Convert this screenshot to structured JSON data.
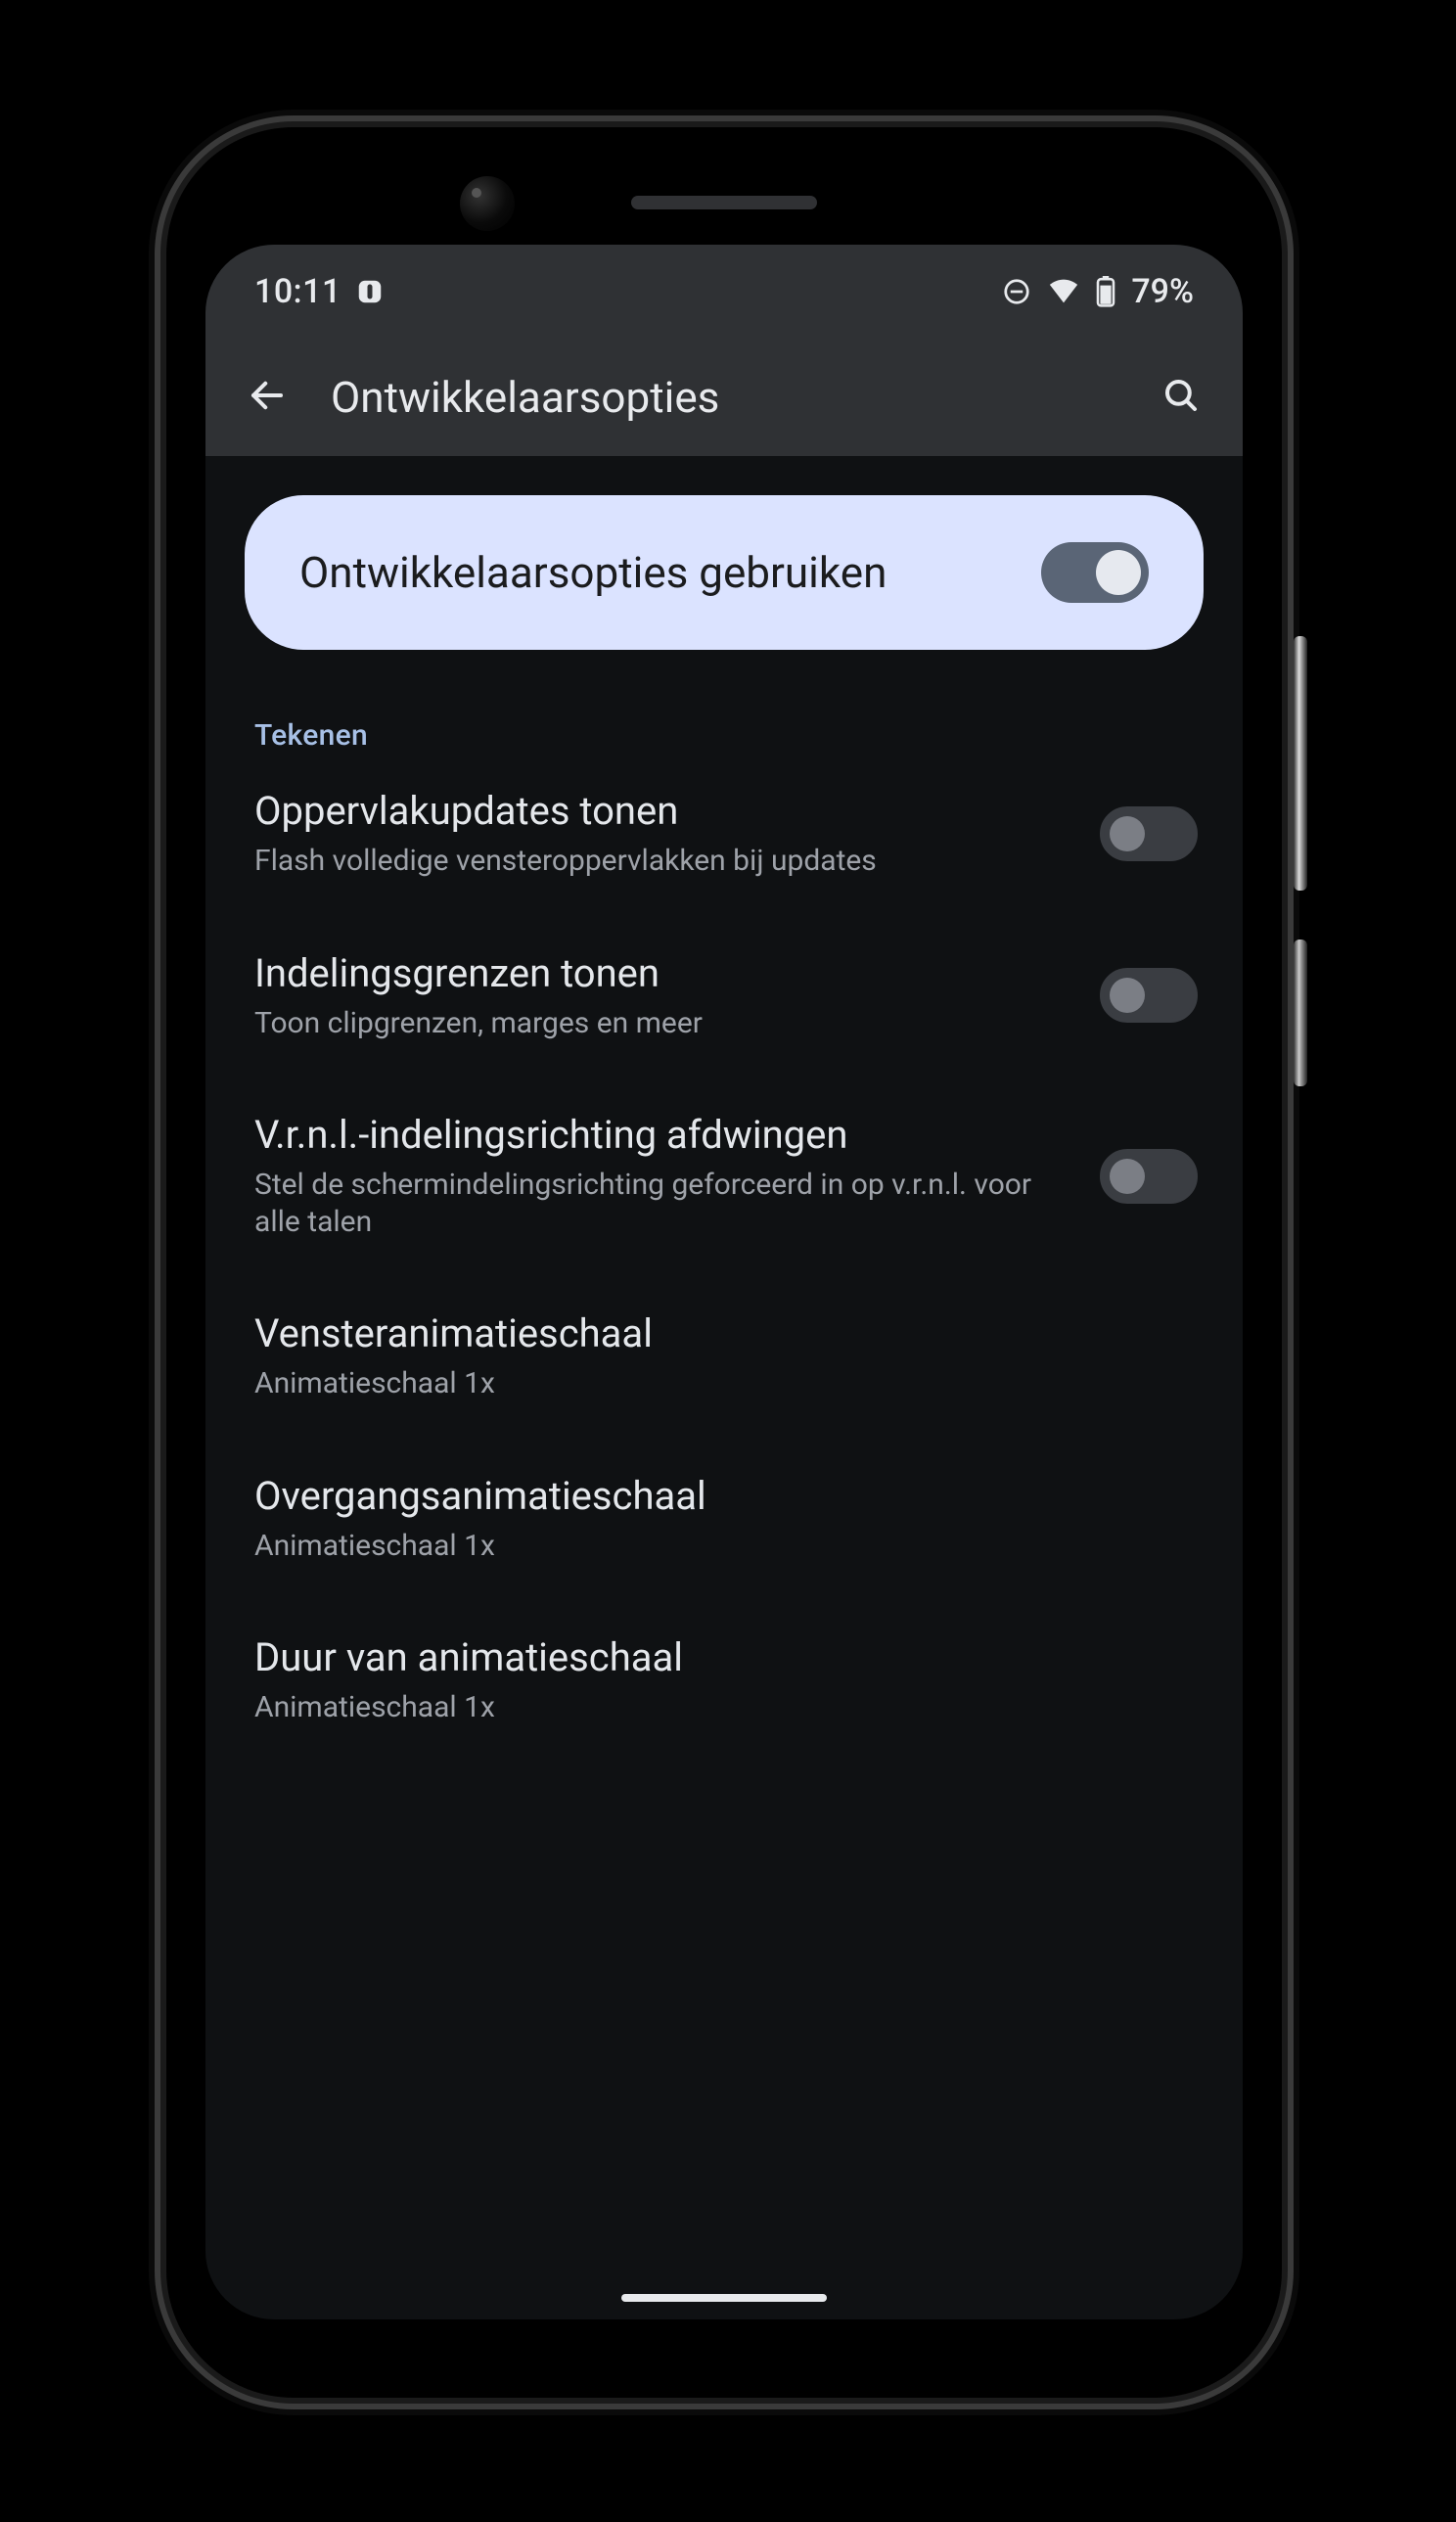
{
  "statusbar": {
    "time": "10:11",
    "battery_text": "79%"
  },
  "appbar": {
    "title": "Ontwikkelaarsopties"
  },
  "master": {
    "label": "Ontwikkelaarsopties gebruiken"
  },
  "section": {
    "header": "Tekenen"
  },
  "rows": [
    {
      "title": "Oppervlakupdates tonen",
      "sub": "Flash volledige vensteroppervlakken bij updates",
      "toggle": true
    },
    {
      "title": "Indelingsgrenzen tonen",
      "sub": "Toon clipgrenzen, marges en meer",
      "toggle": true
    },
    {
      "title": "V.r.n.l.-indelingsrichting afdwingen",
      "sub": "Stel de schermindelingsrichting geforceerd in op v.r.n.l. voor alle talen",
      "toggle": true
    },
    {
      "title": "Vensteranimatieschaal",
      "sub": "Animatieschaal 1x",
      "toggle": false
    },
    {
      "title": "Overgangsanimatieschaal",
      "sub": "Animatieschaal 1x",
      "toggle": false
    },
    {
      "title": "Duur van animatieschaal",
      "sub": "Animatieschaal 1x",
      "toggle": false
    }
  ]
}
